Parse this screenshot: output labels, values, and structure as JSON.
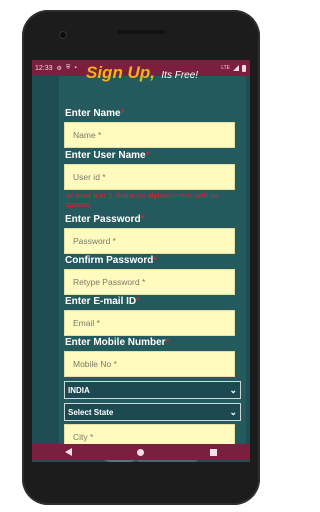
{
  "status": {
    "time": "12:33",
    "network": "LTE"
  },
  "header": {
    "title": "Sign Up,",
    "subtitle": "Its Free!"
  },
  "form": {
    "name": {
      "label": "Enter Name",
      "placeholder": "Name *"
    },
    "userid": {
      "label": "Enter User Name",
      "placeholder": "User id *",
      "error": "At least 8 or 2 character alphanumeric with no spaces"
    },
    "password": {
      "label": "Enter Password",
      "placeholder": "Password *"
    },
    "confirm": {
      "label": "Confirm Password",
      "placeholder": "Retype Password *"
    },
    "email": {
      "label": "Enter E-mail ID",
      "placeholder": "Email *"
    },
    "mobile": {
      "label": "Enter Mobile Number",
      "placeholder": "Mobile No *"
    },
    "country": {
      "value": "INDIA"
    },
    "state": {
      "value": "Select State"
    },
    "city": {
      "placeholder": "City *"
    }
  },
  "required_mark": "*"
}
